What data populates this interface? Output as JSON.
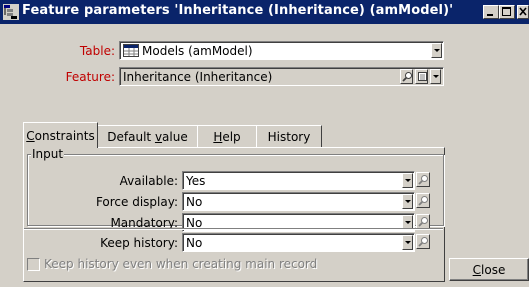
{
  "window": {
    "title": "Feature parameters 'Inheritance (Inheritance) (amModel)'"
  },
  "form": {
    "table_label": "Table:",
    "table_value": "Models (amModel)",
    "feature_label": "Feature:",
    "feature_value": "Inheritance (Inheritance)"
  },
  "tabs": [
    {
      "label": "Constraints",
      "mnemonic_index": 0,
      "active": true
    },
    {
      "label": "Default value",
      "active": false
    },
    {
      "label": "Help",
      "active": false
    },
    {
      "label": "History",
      "active": false
    }
  ],
  "tab_labels": {
    "constraints_prefix": "",
    "constraints_u": "C",
    "constraints_rest": "onstraints",
    "default_prefix": "Default ",
    "default_u": "v",
    "default_rest": "alue",
    "help_prefix": "",
    "help_u": "H",
    "help_rest": "elp",
    "history": "History"
  },
  "input_group": {
    "title": "Input",
    "available_label": "Available:",
    "available_value": "Yes",
    "force_display_label": "Force display:",
    "force_display_value": "No",
    "mandatory_label": "Mandatory:",
    "mandatory_value": "No"
  },
  "history": {
    "keep_history_label": "Keep history:",
    "keep_history_value": "No",
    "keep_main_record_label": "Keep history even when creating main record",
    "keep_main_record_checked": false
  },
  "buttons": {
    "close_u": "C",
    "close_rest": "lose"
  },
  "icons": {
    "app": "tree-window-icon",
    "table": "table-grid-icon",
    "lookup": "magnifier-icon",
    "details": "details-icon",
    "dropdown": "chevron-down-icon"
  },
  "colors": {
    "titlebar": "#0a246a",
    "required_label": "#c00000",
    "face": "#d4d0c8"
  }
}
